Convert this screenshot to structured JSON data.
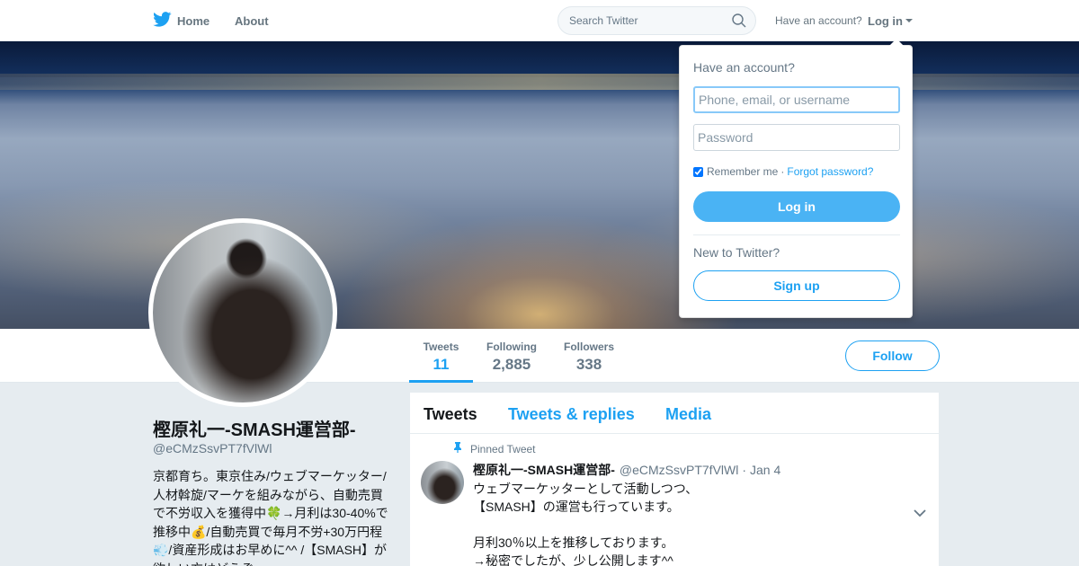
{
  "nav": {
    "home_label": "Home",
    "about_label": "About",
    "search_placeholder": "Search Twitter",
    "have_account_label": "Have an account?",
    "login_label": "Log in"
  },
  "profile": {
    "name": "樫原礼一-SMASH運営部-",
    "handle": "@eCMzSsvPT7fVlWl",
    "bio": "京都育ち。東京住み/ウェブマーケッター/人材斡旋/マーケを組みながら、自動売買で不労収入を獲得中🍀→月利は30-40%で推移中💰/自動売買で毎月不労+30万円程💨/資産形成はお早めに^^ /【SMASH】が欲しい方はどうぞ↓"
  },
  "stats": [
    {
      "label": "Tweets",
      "value": "11"
    },
    {
      "label": "Following",
      "value": "2,885"
    },
    {
      "label": "Followers",
      "value": "338"
    }
  ],
  "follow_label": "Follow",
  "timeline": {
    "tabs": [
      "Tweets",
      "Tweets & replies",
      "Media"
    ],
    "tweet": {
      "pinned_label": "Pinned Tweet",
      "fullname": "樫原礼一-SMASH運営部-",
      "username": "@eCMzSsvPT7fVlWl",
      "separator": "·",
      "date": "Jan 4",
      "text": "ウェブマーケッターとして活動しつつ、\n【SMASH】の運営も行っています。\n\n月利30％以上を推移しております。\n→秘密でしたが、少し公開します^^"
    }
  },
  "login_dropdown": {
    "title": "Have an account?",
    "username_placeholder": "Phone, email, or username",
    "password_placeholder": "Password",
    "remember_label": "Remember me",
    "separator": "·",
    "forgot_label": "Forgot password?",
    "login_button": "Log in",
    "new_label": "New to Twitter?",
    "signup_button": "Sign up"
  },
  "colors": {
    "accent": "#1da1f2",
    "login_button": "#4ab3f4",
    "background": "#e6ecf0"
  },
  "icons": [
    "twitter-bird-icon",
    "search-icon",
    "caret-down-icon",
    "pin-icon",
    "chevron-down-icon"
  ]
}
